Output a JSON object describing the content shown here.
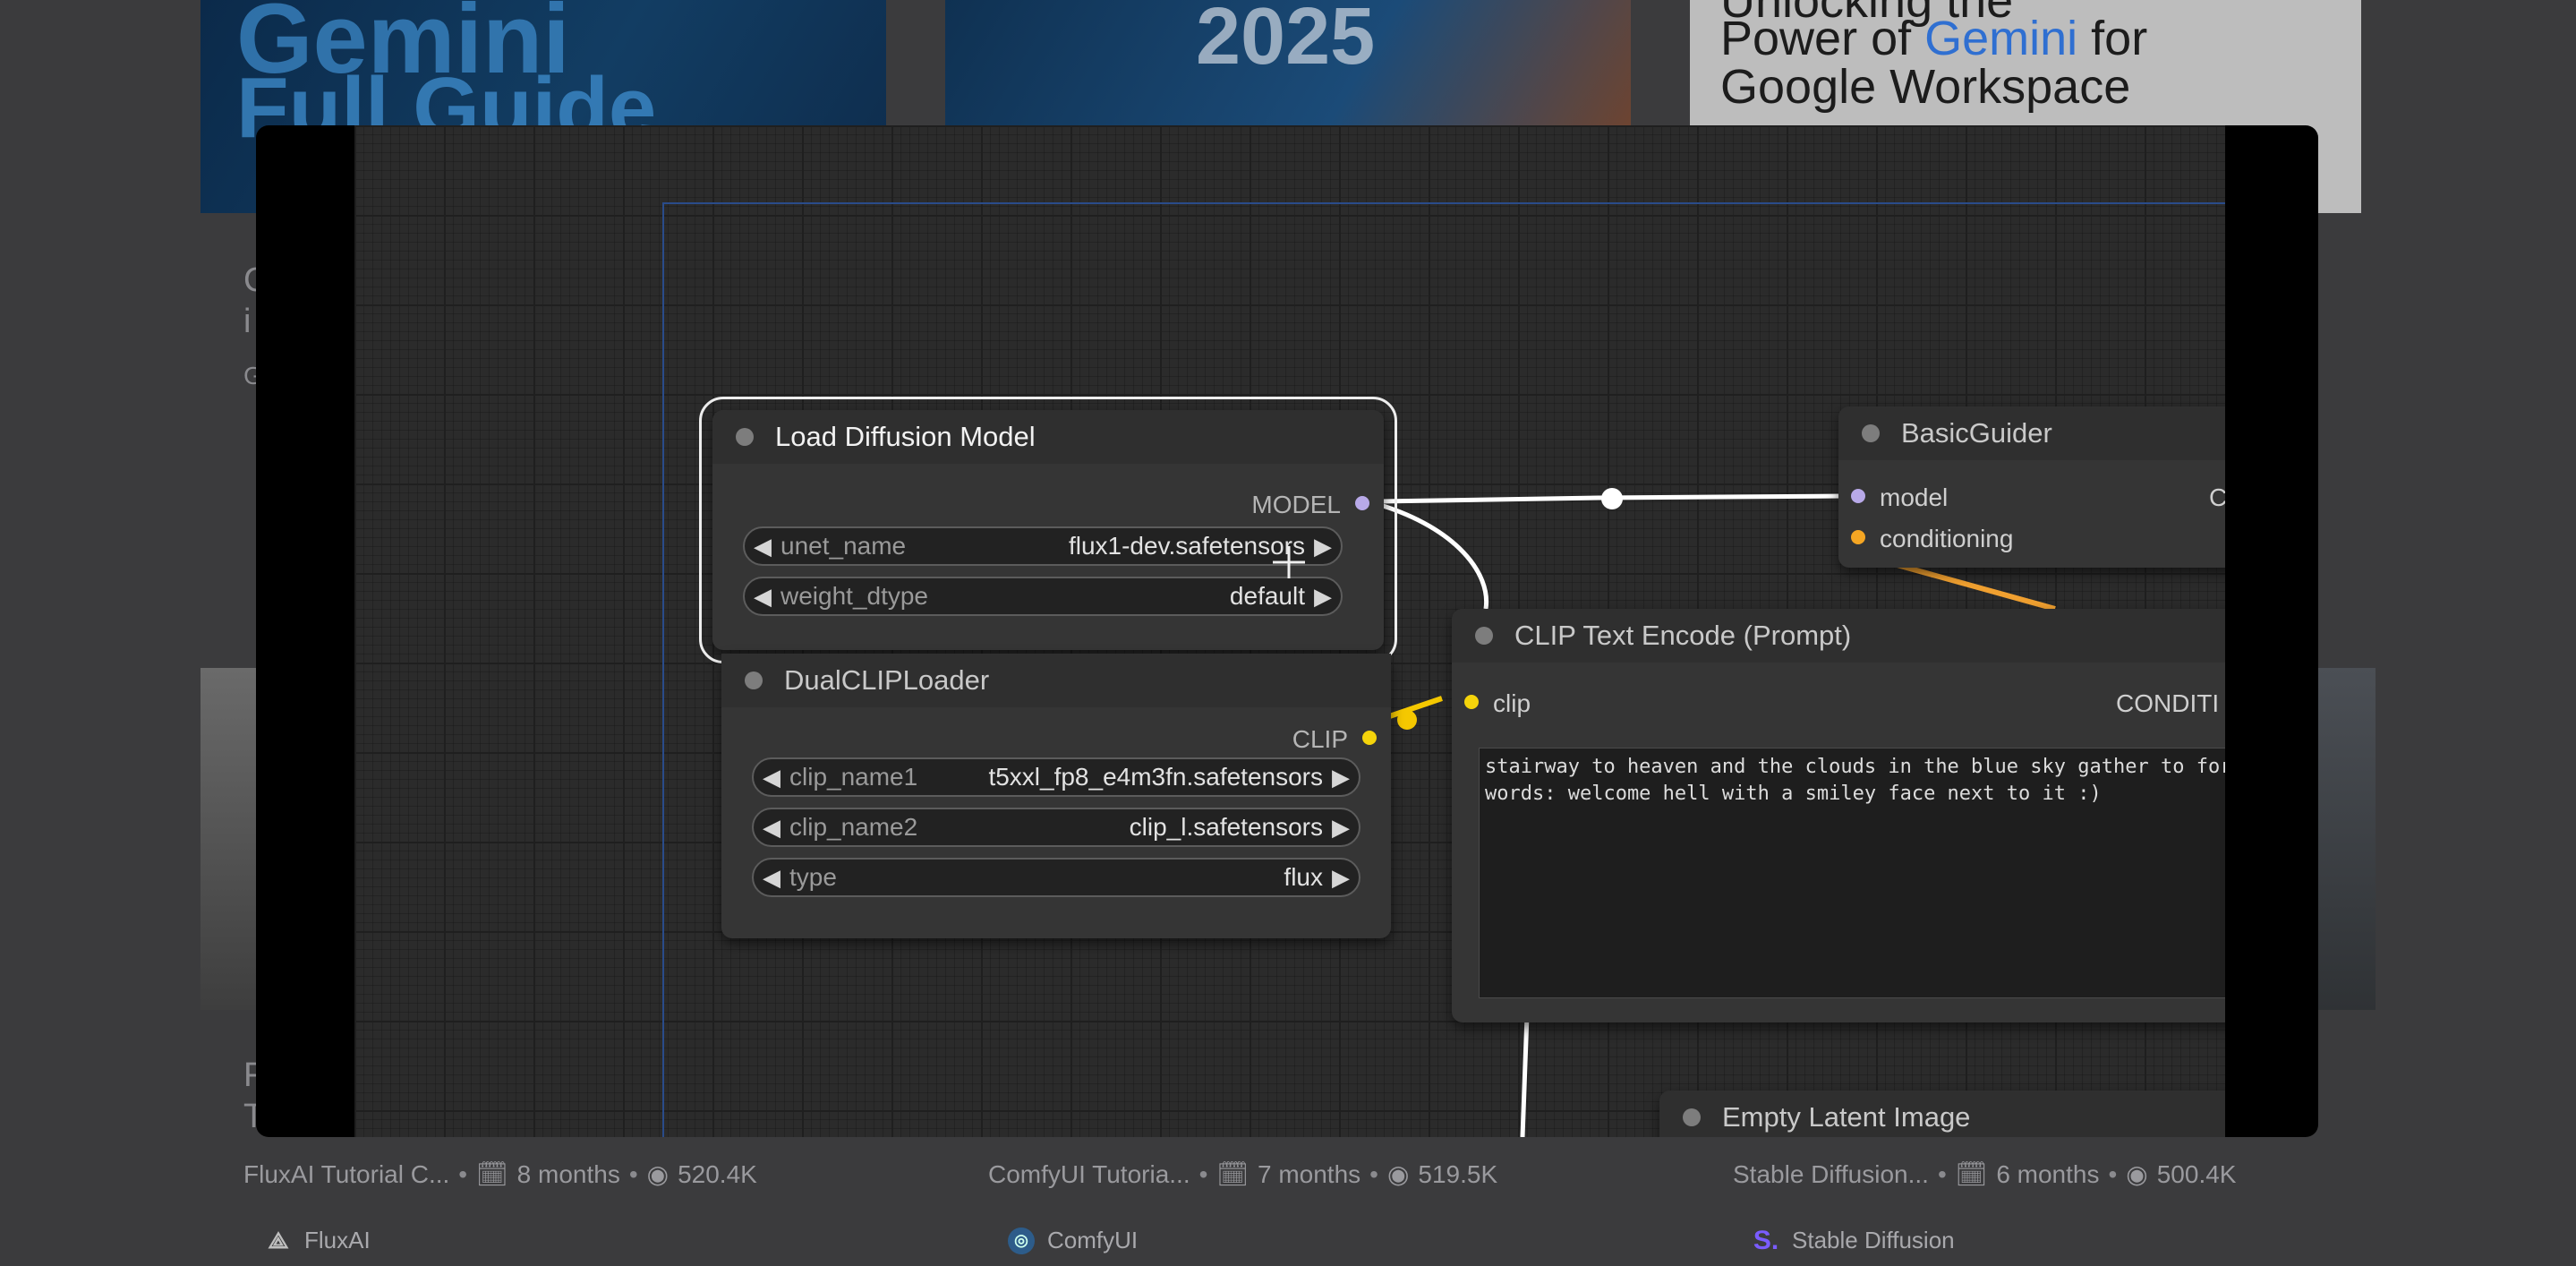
{
  "background": {
    "thumbnails": {
      "first": {
        "line1": "Gemini",
        "line2": "Full Guide"
      },
      "second": {
        "year": "2025"
      },
      "third": {
        "line0": "Unlocking the",
        "line1_pre": "Power of ",
        "line1_highlight": "Gemini",
        "line1_post": " for",
        "line2": "Google Workspace"
      }
    },
    "cards": [
      {
        "title_fragment": "C",
        "title_fragment2": "i",
        "sub_fragment": "G",
        "channel": "FluxAI Tutorial C...",
        "age": "8 months",
        "views": "520.4K",
        "brand": "FluxAI",
        "brand_icon": "fluxai-logo-icon"
      },
      {
        "channel": "ComfyUI Tutoria...",
        "age": "7 months",
        "views": "519.5K",
        "brand": "ComfyUI",
        "brand_icon": "comfyui-logo-icon"
      },
      {
        "channel": "Stable Diffusion...",
        "age": "6 months",
        "views": "500.4K",
        "brand": "Stable Diffusion",
        "brand_icon": "stable-diffusion-logo-icon"
      }
    ],
    "fourth_card_fragment": "F",
    "fourth_card_fragment2": "T"
  },
  "modal": {
    "nodes": {
      "load_diffusion": {
        "title": "Load Diffusion Model",
        "output": "MODEL",
        "widgets": [
          {
            "name": "unet_name",
            "value": "flux1-dev.safetensors"
          },
          {
            "name": "weight_dtype",
            "value": "default"
          }
        ]
      },
      "dual_clip": {
        "title": "DualCLIPLoader",
        "output": "CLIP",
        "widgets": [
          {
            "name": "clip_name1",
            "value": "t5xxl_fp8_e4m3fn.safetensors"
          },
          {
            "name": "clip_name2",
            "value": "clip_l.safetensors"
          },
          {
            "name": "type",
            "value": "flux"
          }
        ]
      },
      "clip_text": {
        "title": "CLIP Text Encode (Prompt)",
        "input": "clip",
        "output": "CONDITI",
        "prompt": "stairway to heaven and the clouds in the blue sky gather to form\nwords: welcome hell with a smiley face next to it :)"
      },
      "basic_guider": {
        "title": "BasicGuider",
        "inputs": [
          "model",
          "conditioning"
        ],
        "output_fragment": "C"
      },
      "empty_latent": {
        "title": "Empty Latent Image"
      }
    },
    "colors": {
      "model_slot": "#b8a9e8",
      "clip_slot": "#f5d40b",
      "conditioning_slot": "#f5a623",
      "wire_model": "#ffffff",
      "wire_clip": "#f5c800",
      "wire_cond": "#f0a030"
    }
  }
}
